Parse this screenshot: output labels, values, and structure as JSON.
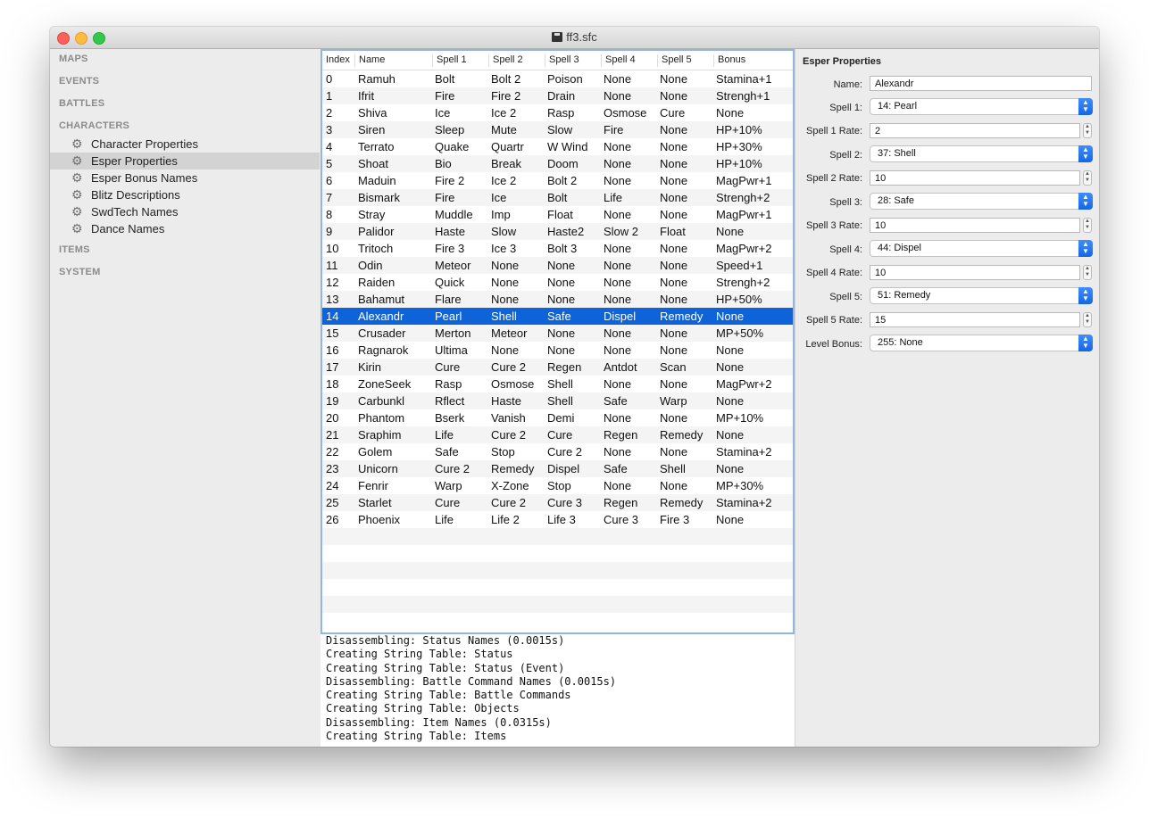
{
  "window": {
    "title": "ff3.sfc"
  },
  "sidebar": {
    "sections": {
      "maps": "MAPS",
      "events": "EVENTS",
      "battles": "BATTLES",
      "characters": "CHARACTERS",
      "items": "ITEMS",
      "system": "SYSTEM"
    },
    "character_items": [
      "Character Properties",
      "Esper Properties",
      "Esper Bonus Names",
      "Blitz Descriptions",
      "SwdTech Names",
      "Dance Names"
    ],
    "selected_item": "Esper Properties"
  },
  "table": {
    "columns": [
      "Index",
      "Name",
      "Spell 1",
      "Spell 2",
      "Spell 3",
      "Spell 4",
      "Spell 5",
      "Bonus"
    ],
    "selected_index": 14,
    "rows": [
      [
        "0",
        "Ramuh",
        "Bolt",
        "Bolt 2",
        "Poison",
        "None",
        "None",
        "Stamina+1"
      ],
      [
        "1",
        "Ifrit",
        "Fire",
        "Fire 2",
        "Drain",
        "None",
        "None",
        "Strengh+1"
      ],
      [
        "2",
        "Shiva",
        "Ice",
        "Ice 2",
        "Rasp",
        "Osmose",
        "Cure",
        "None"
      ],
      [
        "3",
        "Siren",
        "Sleep",
        "Mute",
        "Slow",
        "Fire",
        "None",
        "HP+10%"
      ],
      [
        "4",
        "Terrato",
        "Quake",
        "Quartr",
        "W Wind",
        "None",
        "None",
        "HP+30%"
      ],
      [
        "5",
        "Shoat",
        "Bio",
        "Break",
        "Doom",
        "None",
        "None",
        "HP+10%"
      ],
      [
        "6",
        "Maduin",
        "Fire 2",
        "Ice 2",
        "Bolt 2",
        "None",
        "None",
        "MagPwr+1"
      ],
      [
        "7",
        "Bismark",
        "Fire",
        "Ice",
        "Bolt",
        "Life",
        "None",
        "Strengh+2"
      ],
      [
        "8",
        "Stray",
        "Muddle",
        "Imp",
        "Float",
        "None",
        "None",
        "MagPwr+1"
      ],
      [
        "9",
        "Palidor",
        "Haste",
        "Slow",
        "Haste2",
        "Slow 2",
        "Float",
        "None"
      ],
      [
        "10",
        "Tritoch",
        "Fire 3",
        "Ice 3",
        "Bolt 3",
        "None",
        "None",
        "MagPwr+2"
      ],
      [
        "11",
        "Odin",
        "Meteor",
        "None",
        "None",
        "None",
        "None",
        "Speed+1"
      ],
      [
        "12",
        "Raiden",
        "Quick",
        "None",
        "None",
        "None",
        "None",
        "Strengh+2"
      ],
      [
        "13",
        "Bahamut",
        "Flare",
        "None",
        "None",
        "None",
        "None",
        "HP+50%"
      ],
      [
        "14",
        "Alexandr",
        "Pearl",
        "Shell",
        "Safe",
        "Dispel",
        "Remedy",
        "None"
      ],
      [
        "15",
        "Crusader",
        "Merton",
        "Meteor",
        "None",
        "None",
        "None",
        "MP+50%"
      ],
      [
        "16",
        "Ragnarok",
        "Ultima",
        "None",
        "None",
        "None",
        "None",
        "None"
      ],
      [
        "17",
        "Kirin",
        "Cure",
        "Cure 2",
        "Regen",
        "Antdot",
        "Scan",
        "None"
      ],
      [
        "18",
        "ZoneSeek",
        "Rasp",
        "Osmose",
        "Shell",
        "None",
        "None",
        "MagPwr+2"
      ],
      [
        "19",
        "Carbunkl",
        "Rflect",
        "Haste",
        "Shell",
        "Safe",
        "Warp",
        "None"
      ],
      [
        "20",
        "Phantom",
        "Bserk",
        "Vanish",
        "Demi",
        "None",
        "None",
        "MP+10%"
      ],
      [
        "21",
        "Sraphim",
        "Life",
        "Cure 2",
        "Cure",
        "Regen",
        "Remedy",
        "None"
      ],
      [
        "22",
        "Golem",
        "Safe",
        "Stop",
        "Cure 2",
        "None",
        "None",
        "Stamina+2"
      ],
      [
        "23",
        "Unicorn",
        "Cure 2",
        "Remedy",
        "Dispel",
        "Safe",
        "Shell",
        "None"
      ],
      [
        "24",
        "Fenrir",
        "Warp",
        "X-Zone",
        "Stop",
        "None",
        "None",
        "MP+30%"
      ],
      [
        "25",
        "Starlet",
        "Cure",
        "Cure 2",
        "Cure 3",
        "Regen",
        "Remedy",
        "Stamina+2"
      ],
      [
        "26",
        "Phoenix",
        "Life",
        "Life 2",
        "Life 3",
        "Cure 3",
        "Fire 3",
        "None"
      ]
    ]
  },
  "console": {
    "lines": [
      "Disassembling: Status Names (0.0015s)",
      "Creating String Table: Status",
      "Creating String Table: Status (Event)",
      "Disassembling: Battle Command Names (0.0015s)",
      "Creating String Table: Battle Commands",
      "Creating String Table: Objects",
      "Disassembling: Item Names (0.0315s)",
      "Creating String Table: Items"
    ]
  },
  "properties": {
    "title": "Esper Properties",
    "name_label": "Name:",
    "name_value": "Alexandr",
    "spell1_label": "Spell 1:",
    "spell1_value": "14: Pearl",
    "spell1_rate_label": "Spell 1 Rate:",
    "spell1_rate_value": "2",
    "spell2_label": "Spell 2:",
    "spell2_value": "37: Shell",
    "spell2_rate_label": "Spell 2 Rate:",
    "spell2_rate_value": "10",
    "spell3_label": "Spell 3:",
    "spell3_value": "28: Safe",
    "spell3_rate_label": "Spell 3 Rate:",
    "spell3_rate_value": "10",
    "spell4_label": "Spell 4:",
    "spell4_value": "44: Dispel",
    "spell4_rate_label": "Spell 4 Rate:",
    "spell4_rate_value": "10",
    "spell5_label": "Spell 5:",
    "spell5_value": "51: Remedy",
    "spell5_rate_label": "Spell 5 Rate:",
    "spell5_rate_value": "15",
    "level_bonus_label": "Level Bonus:",
    "level_bonus_value": "255: None"
  }
}
